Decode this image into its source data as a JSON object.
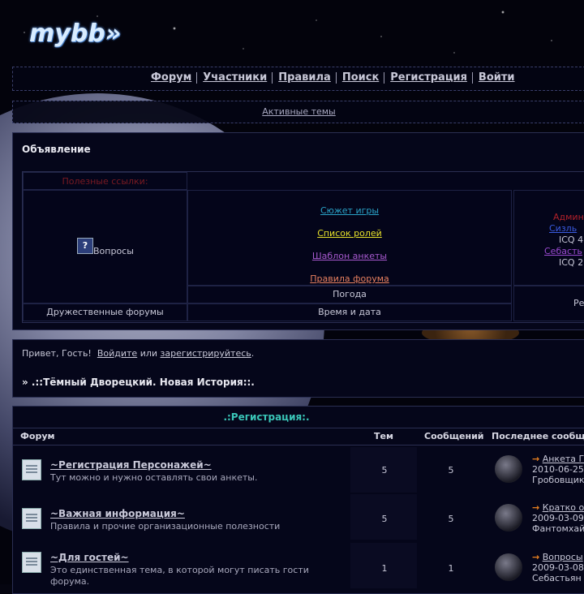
{
  "logo": "mybb»",
  "nav": [
    "Форум",
    "Участники",
    "Правила",
    "Поиск",
    "Регистрация",
    "Войти"
  ],
  "active_topics": "Активные темы",
  "announcement": {
    "title": "Объявление",
    "useful_links_title": "Полезные ссылки:",
    "questions_label": "Вопросы",
    "questions_icon": "help-icon",
    "links": [
      "Сюжет игры",
      "Список ролей",
      "Шаблон анкеты",
      "Правила форума"
    ],
    "weather": "Погода",
    "friendly_forums": "Дружественные форумы",
    "time_and_date": "Время и дата",
    "admins": {
      "title": "Админ",
      "line1": "Сизль",
      "icq1": "ICQ 4",
      "line2": "Себасть",
      "icq2": "ICQ 2"
    },
    "right_cell": "Ре"
  },
  "guest": {
    "greeting": "Привет, Гость!",
    "login": "Войдите",
    "or": "или",
    "register": "зарегистрируйтесь",
    "period": ".",
    "breadcrumb": "» .::Тёмный Дворецкий. Новая История::."
  },
  "forum_section": {
    "category": ".:Регистрация:.",
    "headers": {
      "forum": "Форум",
      "topics": "Тем",
      "posts": "Сообщений",
      "last_post": "Последнее сообщен"
    },
    "rows": [
      {
        "name": "~Регистрация Персонажей~",
        "desc": "Тут можно и нужно оставлять свои анкеты.",
        "topics": "5",
        "posts": "5",
        "last_title": "Анкета Г",
        "last_date": "2010-06-25",
        "last_author": "Гробовщик"
      },
      {
        "name": "~Важная информация~",
        "desc": "Правила и прочие организационные полезности",
        "topics": "5",
        "posts": "5",
        "last_title": "Кратко о",
        "last_date": "2009-03-09",
        "last_author": "Фантомхайв"
      },
      {
        "name": "~Для гостей~",
        "desc": "Это единственная тема, в которой могут писать гости форума.",
        "topics": "1",
        "posts": "1",
        "last_title": "Вопросы",
        "last_date": "2009-03-08",
        "last_author": "Себастьян"
      }
    ]
  }
}
